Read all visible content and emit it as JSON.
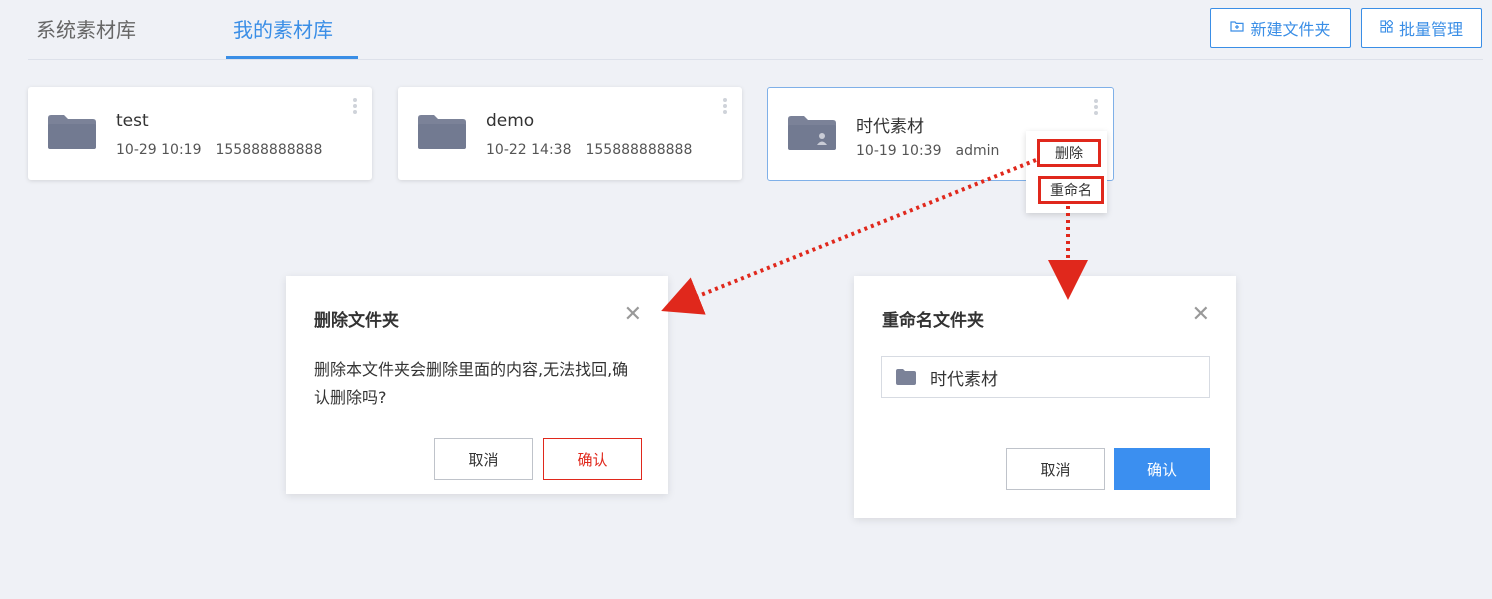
{
  "tabs": [
    {
      "label": "系统素材库",
      "active": false
    },
    {
      "label": "我的素材库",
      "active": true
    }
  ],
  "header_buttons": {
    "new_folder": "新建文件夹",
    "batch_manage": "批量管理"
  },
  "folders": [
    {
      "name": "test",
      "date": "10-29 10:19",
      "owner": "155888888888"
    },
    {
      "name": "demo",
      "date": "10-22 14:38",
      "owner": "155888888888"
    },
    {
      "name": "时代素材",
      "date": "10-19 10:39",
      "owner": "admin"
    }
  ],
  "context_menu": {
    "delete": "删除",
    "rename": "重命名"
  },
  "delete_dialog": {
    "title": "删除文件夹",
    "message": "删除本文件夹会删除里面的内容,无法找回,确认删除吗?",
    "cancel": "取消",
    "confirm": "确认"
  },
  "rename_dialog": {
    "title": "重命名文件夹",
    "input_value": "时代素材",
    "cancel": "取消",
    "confirm": "确认"
  },
  "colors": {
    "accent": "#3a8ee6",
    "danger": "#e0281c",
    "folder": "#7b8298",
    "background": "#eff1f6"
  },
  "icons": {
    "folder": "folder-icon",
    "shared_folder": "shared-folder-icon",
    "more": "more-vertical-icon",
    "close": "close-icon",
    "new_folder": "folder-plus-icon",
    "batch": "grid-icon"
  }
}
